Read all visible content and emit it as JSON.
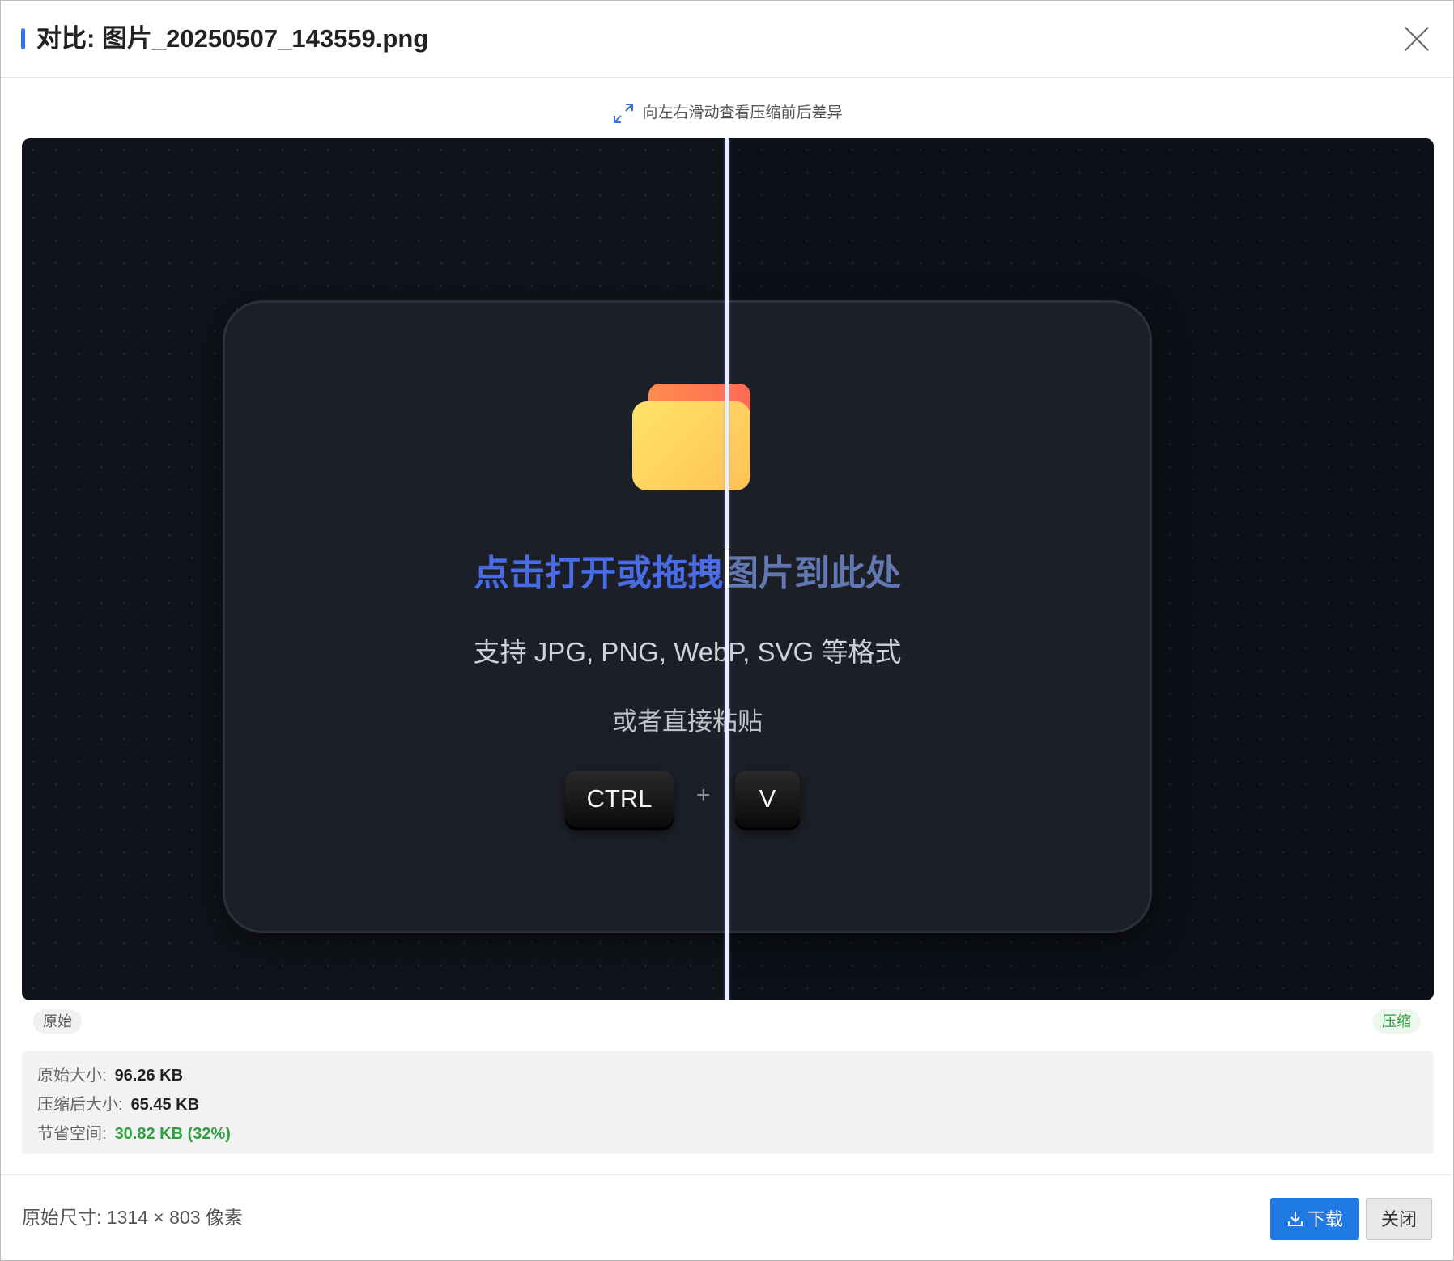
{
  "dialog": {
    "title": "对比: 图片_20250507_143559.png",
    "hint": "向左右滑动查看压缩前后差异"
  },
  "preview": {
    "drop_title_part1": "点击打开或拖拽",
    "drop_title_part2": "图片到此处",
    "formats": "支持 JPG, PNG, WebP, SVG 等格式",
    "or_paste": "或者直接粘贴",
    "key_ctrl": "CTRL",
    "plus": "+",
    "key_v": "V"
  },
  "labels": {
    "original": "原始",
    "compressed": "压缩"
  },
  "stats": {
    "original_size_label": "原始大小:",
    "original_size": "96.26 KB",
    "compressed_size_label": "压缩后大小:",
    "compressed_size": "65.45 KB",
    "saved_label": "节省空间:",
    "saved": "30.82 KB (32%)"
  },
  "footer": {
    "dimensions": "原始尺寸: 1314 × 803 像素",
    "download_label": "下载",
    "close_label": "关闭"
  },
  "colors": {
    "accent": "#2f6cf6",
    "download_button": "#1f7be3",
    "saved_green": "#2ea043"
  }
}
